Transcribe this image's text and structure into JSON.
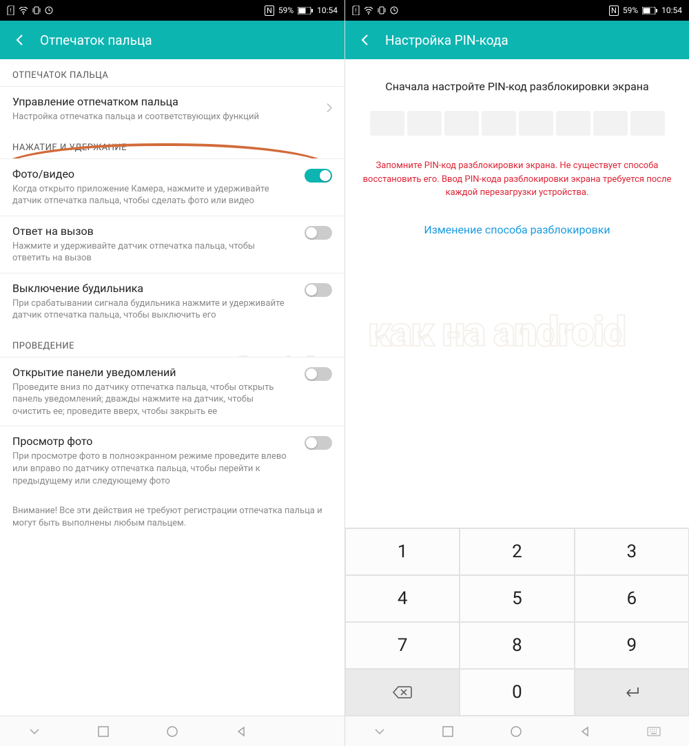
{
  "status": {
    "battery": "59%",
    "time": "10:54"
  },
  "screen1": {
    "title": "Отпечаток пальца",
    "sections": [
      {
        "header": "ОТПЕЧАТОК ПАЛЬЦА"
      },
      {
        "header": "НАЖАТИЕ И УДЕРЖАНИЕ"
      },
      {
        "header": "ПРОВЕДЕНИЕ"
      }
    ],
    "items": {
      "manage": {
        "title": "Управление отпечатком пальца",
        "desc": "Настройка отпечатка пальца и соответствующих функций"
      },
      "photo": {
        "title": "Фото/видео",
        "desc": "Когда открыто приложение Камера, нажмите и удерживайте датчик отпечатка пальца, чтобы сделать фото или видео",
        "on": true
      },
      "answer": {
        "title": "Ответ на вызов",
        "desc": "Нажмите и удерживайте датчик отпечатка пальца, чтобы ответить на вызов",
        "on": false
      },
      "alarm": {
        "title": "Выключение будильника",
        "desc": "При срабатывании сигнала будильника нажмите и удерживайте датчик отпечатка пальца, чтобы выключить его",
        "on": false
      },
      "panel": {
        "title": "Открытие панели уведомлений",
        "desc": "Проведите вниз по датчику отпечатка пальца, чтобы открыть панель уведомлений; дважды нажмите на датчик, чтобы очистить ее; проведите вверх, чтобы закрыть ее",
        "on": false
      },
      "photos": {
        "title": "Просмотр фото",
        "desc": "При просмотре фото в полноэкранном режиме проведите влево или вправо по датчику отпечатка пальца, чтобы перейти к предыдущему или следующему фото",
        "on": false
      }
    },
    "note": "Внимание! Все эти действия не требуют регистрации отпечатка пальца и могут быть выполнены любым пальцем."
  },
  "screen2": {
    "title": "Настройка PIN-кода",
    "prompt": "Сначала настройте PIN-код разблокировки экрана",
    "warning": "Запомните PIN-код разблокировки экрана. Не существует способа восстановить его. Ввод PIN-кода разблокировки экрана требуется после каждой перезагрузки устройства.",
    "link": "Изменение способа разблокировки",
    "keypad": [
      [
        "1",
        "2",
        "3"
      ],
      [
        "4",
        "5",
        "6"
      ],
      [
        "7",
        "8",
        "9"
      ],
      [
        "back",
        "0",
        "enter"
      ]
    ]
  },
  "watermark": "как на android"
}
